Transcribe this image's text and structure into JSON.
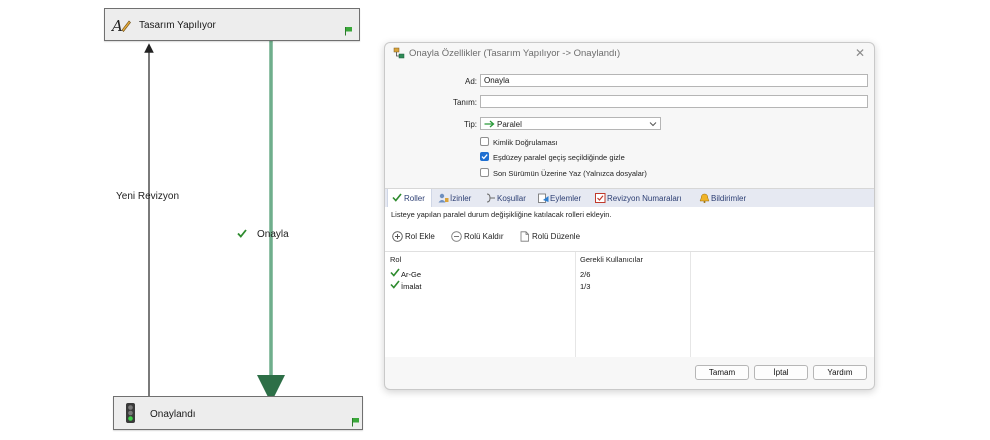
{
  "diagram": {
    "top_state": {
      "label": "Tasarım Yapılıyor",
      "icon": "design-pen-icon"
    },
    "bottom_state": {
      "label": "Onaylandı",
      "icon": "traffic-light-icon"
    },
    "left_transition": {
      "label": "Yeni Revizyon"
    },
    "right_transition": {
      "label": "Onayla",
      "icon": "green-check-icon"
    },
    "colors": {
      "approve_line": "#6fae8c",
      "revise_line": "#222222",
      "flag": "#3aa83a"
    }
  },
  "dialog": {
    "title": "Onayla Özellikler (Tasarım Yapılıyor -> Onaylandı)",
    "close_glyph": "✕",
    "fields": {
      "name_label": "Ad:",
      "name_value": "Onayla",
      "desc_label": "Tanım:",
      "desc_value": "",
      "type_label": "Tip:",
      "type_value": "Paralel"
    },
    "checkboxes": [
      {
        "label": "Kimlik Doğrulaması",
        "checked": false
      },
      {
        "label": "Eşdüzey paralel geçiş seçildiğinde gizle",
        "checked": true
      },
      {
        "label": "Son Sürümün Üzerine Yaz (Yalnızca dosyalar)",
        "checked": false
      }
    ],
    "tabs": [
      {
        "label": "Roller",
        "icon": "check-icon",
        "active": true
      },
      {
        "label": "İzinler",
        "icon": "permissions-icon",
        "active": false
      },
      {
        "label": "Koşullar",
        "icon": "conditions-icon",
        "active": false
      },
      {
        "label": "Eylemler",
        "icon": "actions-icon",
        "active": false
      },
      {
        "label": "Revizyon Numaraları",
        "icon": "revision-icon",
        "active": false
      },
      {
        "label": "Bildirimler",
        "icon": "bell-icon",
        "active": false
      }
    ],
    "roles_tab": {
      "hint": "Listeye yapılan paralel durum değişikliğine katılacak rolleri ekleyin.",
      "toolbar": [
        {
          "label": "Rol Ekle",
          "icon": "add-circle-icon"
        },
        {
          "label": "Rolü Kaldır",
          "icon": "remove-circle-icon"
        },
        {
          "label": "Rolü Düzenle",
          "icon": "document-icon"
        }
      ],
      "columns": [
        "Rol",
        "Gerekli Kullanıcılar"
      ],
      "rows": [
        {
          "role": "Ar-Ge",
          "users": "2/6"
        },
        {
          "role": "İmalat",
          "users": "1/3"
        }
      ]
    },
    "buttons": {
      "ok": "Tamam",
      "cancel": "İptal",
      "help": "Yardım"
    }
  }
}
